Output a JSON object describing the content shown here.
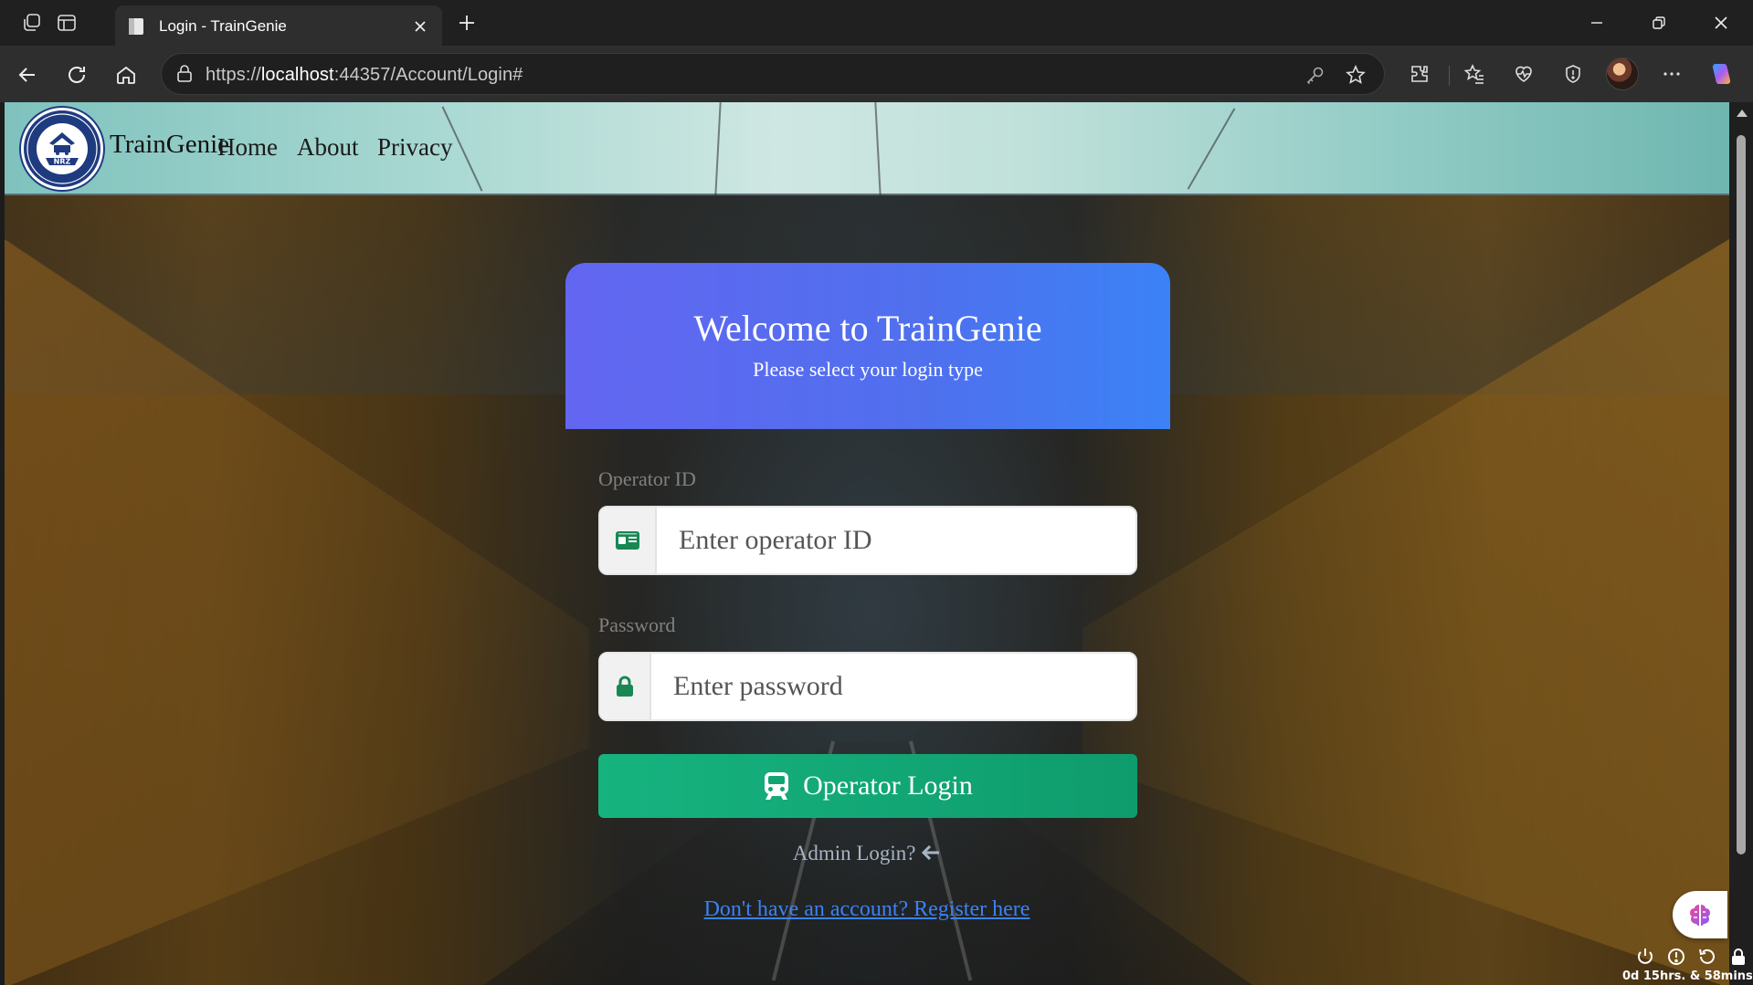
{
  "browser": {
    "tab_title": "Login - TrainGenie",
    "url_prefix": "https://",
    "url_host": "localhost",
    "url_rest": ":44357/Account/Login#"
  },
  "site": {
    "brand": "TrainGenie",
    "logo_text": "NRZ",
    "nav": {
      "home": "Home",
      "about": "About",
      "privacy": "Privacy"
    }
  },
  "login": {
    "title": "Welcome to TrainGenie",
    "subtitle": "Please select your login type",
    "operator_id_label": "Operator ID",
    "operator_id_placeholder": "Enter operator ID",
    "operator_id_value": "",
    "password_label": "Password",
    "password_placeholder": "Enter password",
    "password_value": "",
    "submit_label": "Operator Login",
    "admin_link": "Admin Login?",
    "register_link": "Don't have an account? Register here"
  },
  "tray": {
    "uptime": "0d 15hrs. & 58mins."
  },
  "colors": {
    "card_header_start": "#6366f1",
    "card_header_end": "#3b82f6",
    "button_green": "#10a877",
    "link_blue": "#3b82f6"
  },
  "icons": {
    "operator_field": "id-card-icon",
    "password_field": "lock-icon",
    "submit": "train-icon",
    "admin": "arrow-left-icon"
  }
}
